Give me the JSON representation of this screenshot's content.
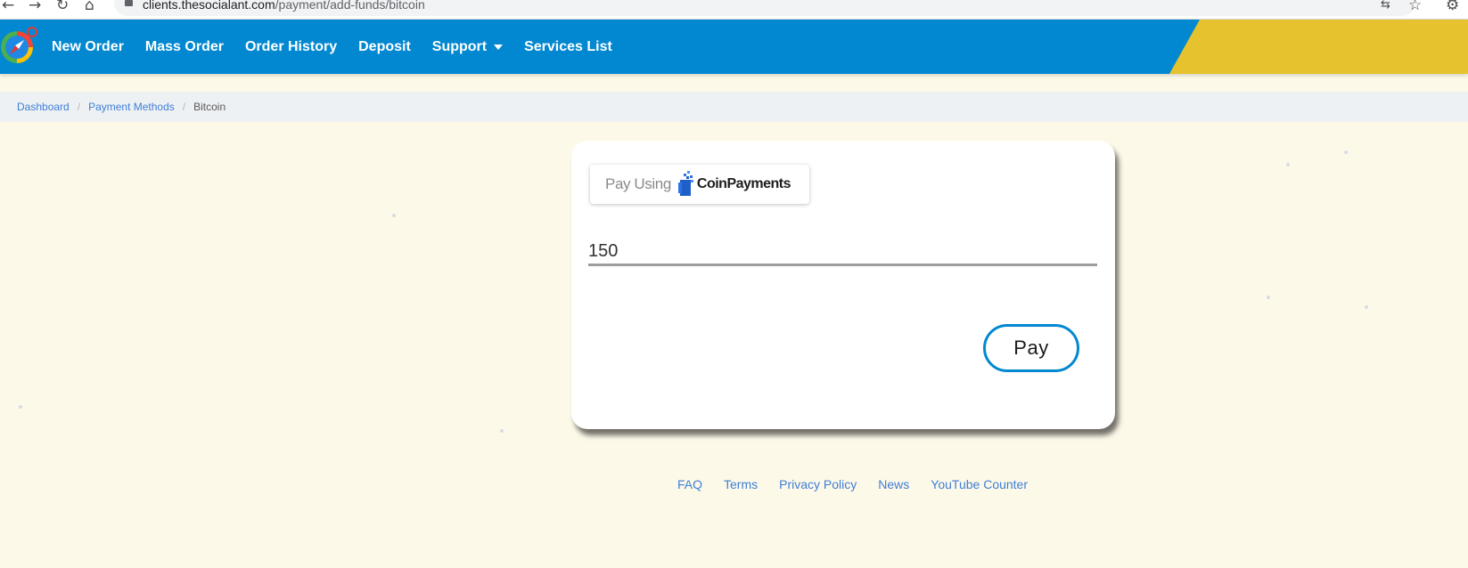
{
  "browser": {
    "url_host": "clients.thesocialant.com",
    "url_path": "/payment/add-funds/bitcoin"
  },
  "navbar": {
    "items": [
      {
        "label": "New Order"
      },
      {
        "label": "Mass Order"
      },
      {
        "label": "Order History"
      },
      {
        "label": "Deposit"
      },
      {
        "label": "Support"
      },
      {
        "label": "Services List"
      }
    ],
    "accent_color": "#0288d1",
    "secondary_color": "#e6c22e"
  },
  "breadcrumb": {
    "items": [
      "Dashboard",
      "Payment Methods",
      "Bitcoin"
    ],
    "separator": "/"
  },
  "payment": {
    "badge_prefix": "Pay Using",
    "badge_brand": "CoinPayments",
    "amount_value": "150",
    "pay_label": "Pay"
  },
  "footer": {
    "links": [
      "FAQ",
      "Terms",
      "Privacy Policy",
      "News",
      "YouTube Counter"
    ]
  }
}
